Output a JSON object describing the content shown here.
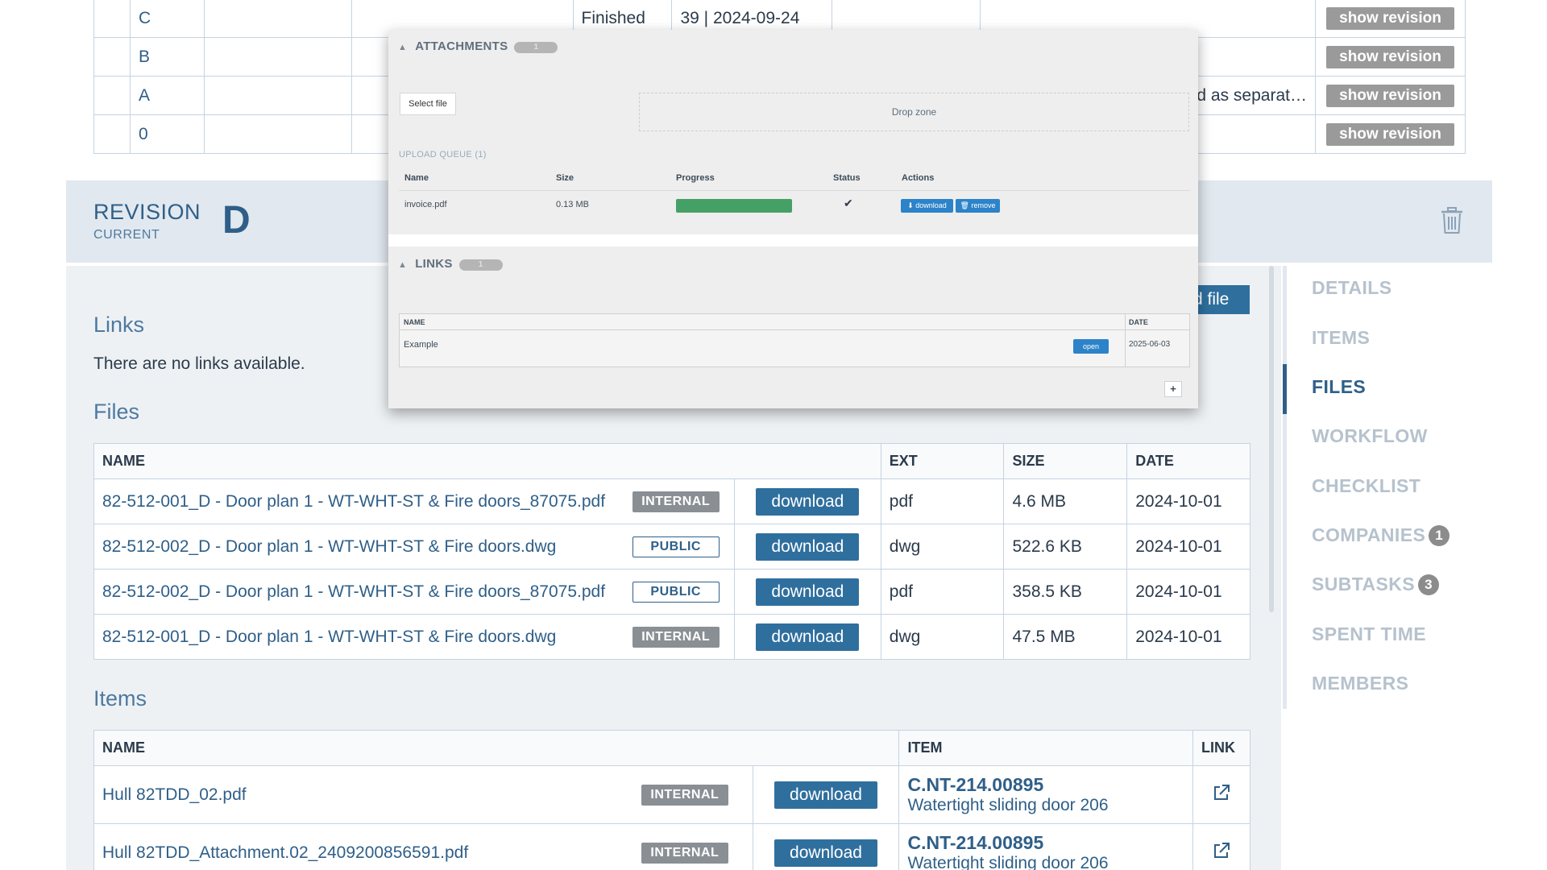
{
  "revision_history": {
    "rows": [
      {
        "letter": "C",
        "status": "Finished",
        "date": "39 | 2024-09-24",
        "description": "",
        "action": "show revision"
      },
      {
        "letter": "B",
        "status": "",
        "date": "",
        "description": "",
        "action": "show revision"
      },
      {
        "letter": "A",
        "status": "",
        "date": "",
        "description": "ed as separat…",
        "action": "show revision"
      },
      {
        "letter": "0",
        "status": "",
        "date": "",
        "description": "",
        "action": "show revision"
      }
    ]
  },
  "revision": {
    "title": "REVISION",
    "subtitle": "CURRENT",
    "letter": "D",
    "delete_icon": "trash-icon"
  },
  "links_section": {
    "title": "Links",
    "empty_text": "There are no links available."
  },
  "files_section": {
    "title": "Files",
    "upload_label": "d file",
    "columns": {
      "name": "NAME",
      "ext": "EXT",
      "size": "SIZE",
      "date": "DATE"
    },
    "rows": [
      {
        "name": "82-512-001_D - Door plan 1 - WT-WHT-ST & Fire doors_87075.pdf",
        "visibility": "INTERNAL",
        "action": "download",
        "ext": "pdf",
        "size": "4.6 MB",
        "date": "2024-10-01"
      },
      {
        "name": "82-512-002_D - Door plan 1 - WT-WHT-ST & Fire doors.dwg",
        "visibility": "PUBLIC",
        "action": "download",
        "ext": "dwg",
        "size": "522.6 KB",
        "date": "2024-10-01"
      },
      {
        "name": "82-512-002_D - Door plan 1 - WT-WHT-ST & Fire doors_87075.pdf",
        "visibility": "PUBLIC",
        "action": "download",
        "ext": "pdf",
        "size": "358.5 KB",
        "date": "2024-10-01"
      },
      {
        "name": "82-512-001_D - Door plan 1 - WT-WHT-ST & Fire doors.dwg",
        "visibility": "INTERNAL",
        "action": "download",
        "ext": "dwg",
        "size": "47.5 MB",
        "date": "2024-10-01"
      }
    ]
  },
  "items_section": {
    "title": "Items",
    "columns": {
      "name": "NAME",
      "item": "ITEM",
      "link": "LINK"
    },
    "rows": [
      {
        "name": "Hull 82TDD_02.pdf",
        "visibility": "INTERNAL",
        "action": "download",
        "item_code": "C.NT-214.00895",
        "item_desc": "Watertight sliding door 206",
        "link_icon": "external-link-icon"
      },
      {
        "name": "Hull 82TDD_Attachment.02_2409200856591.pdf",
        "visibility": "INTERNAL",
        "action": "download",
        "item_code": "C.NT-214.00895",
        "item_desc": "Watertight sliding door 206",
        "link_icon": "external-link-icon"
      }
    ]
  },
  "side_nav": {
    "items": [
      {
        "label": "DETAILS",
        "count": "",
        "active": false
      },
      {
        "label": "ITEMS",
        "count": "",
        "active": false
      },
      {
        "label": "FILES",
        "count": "",
        "active": true
      },
      {
        "label": "WORKFLOW",
        "count": "",
        "active": false
      },
      {
        "label": "CHECKLIST",
        "count": "",
        "active": false
      },
      {
        "label": "COMPANIES",
        "count": "1",
        "active": false
      },
      {
        "label": "SUBTASKS",
        "count": "3",
        "active": false
      },
      {
        "label": "SPENT TIME",
        "count": "",
        "active": false
      },
      {
        "label": "MEMBERS",
        "count": "",
        "active": false
      }
    ]
  },
  "overlay": {
    "attachments": {
      "title": "ATTACHMENTS",
      "count": "1",
      "select_file": "Select file",
      "drop_zone": "Drop zone",
      "queue_label": "UPLOAD QUEUE (1)",
      "columns": {
        "name": "Name",
        "size": "Size",
        "progress": "Progress",
        "status": "Status",
        "actions": "Actions"
      },
      "row": {
        "name": "invoice.pdf",
        "size": "0.13 MB",
        "progress": 1.0,
        "status_icon": "check-icon",
        "download_label": "download",
        "remove_label": "remove"
      }
    },
    "links": {
      "title": "LINKS",
      "count": "1",
      "columns": {
        "name": "NAME",
        "date": "DATE"
      },
      "row": {
        "name": "Example",
        "open_label": "open",
        "date": "2025-06-03"
      },
      "add_label": "+"
    }
  },
  "colors": {
    "brand_blue": "#2f5f88",
    "button_blue": "#2f6f9e",
    "internal_badge": "#8a8f94",
    "progress_green": "#45a066",
    "nav_inactive": "#b6c2cd"
  }
}
